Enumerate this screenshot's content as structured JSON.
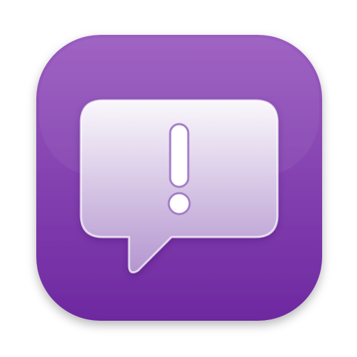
{
  "icon": {
    "glyph": "exclamation-mark",
    "shape": "speech-bubble",
    "colors": {
      "background_top": "#9a5cc0",
      "background_bottom": "#6e28a0",
      "bubble_top": "#ffffff",
      "bubble_bottom": "#b79ad2",
      "glyph": "#7a36aa"
    }
  }
}
